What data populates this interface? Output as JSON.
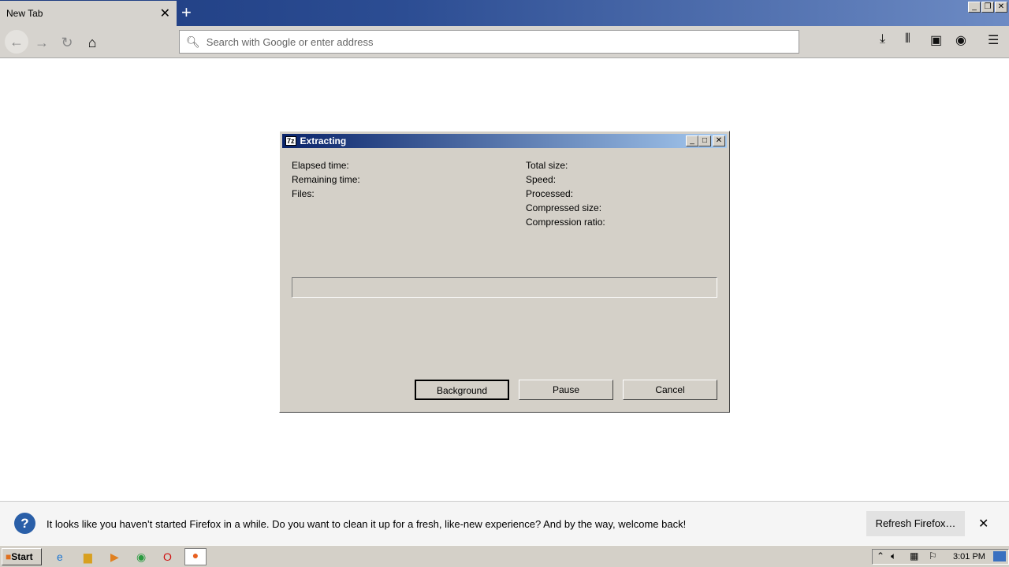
{
  "browser": {
    "tab_title": "New Tab",
    "url_placeholder": "Search with Google or enter address"
  },
  "dialog": {
    "title": "Extracting",
    "logo": "7z",
    "left_labels": [
      "Elapsed time:",
      "Remaining time:",
      "Files:"
    ],
    "right_labels": [
      "Total size:",
      "Speed:",
      "Processed:",
      "Compressed size:",
      "Compression ratio:"
    ],
    "progress": 0,
    "buttons": {
      "background": "Background",
      "pause": "Pause",
      "cancel": "Cancel"
    }
  },
  "notification": {
    "message": "It looks like you haven’t started Firefox in a while. Do you want to clean it up for a fresh, like-new experience? And by the way, welcome back!",
    "refresh_button": "Refresh Firefox…"
  },
  "taskbar": {
    "start": "Start",
    "clock": "3:01 PM"
  }
}
